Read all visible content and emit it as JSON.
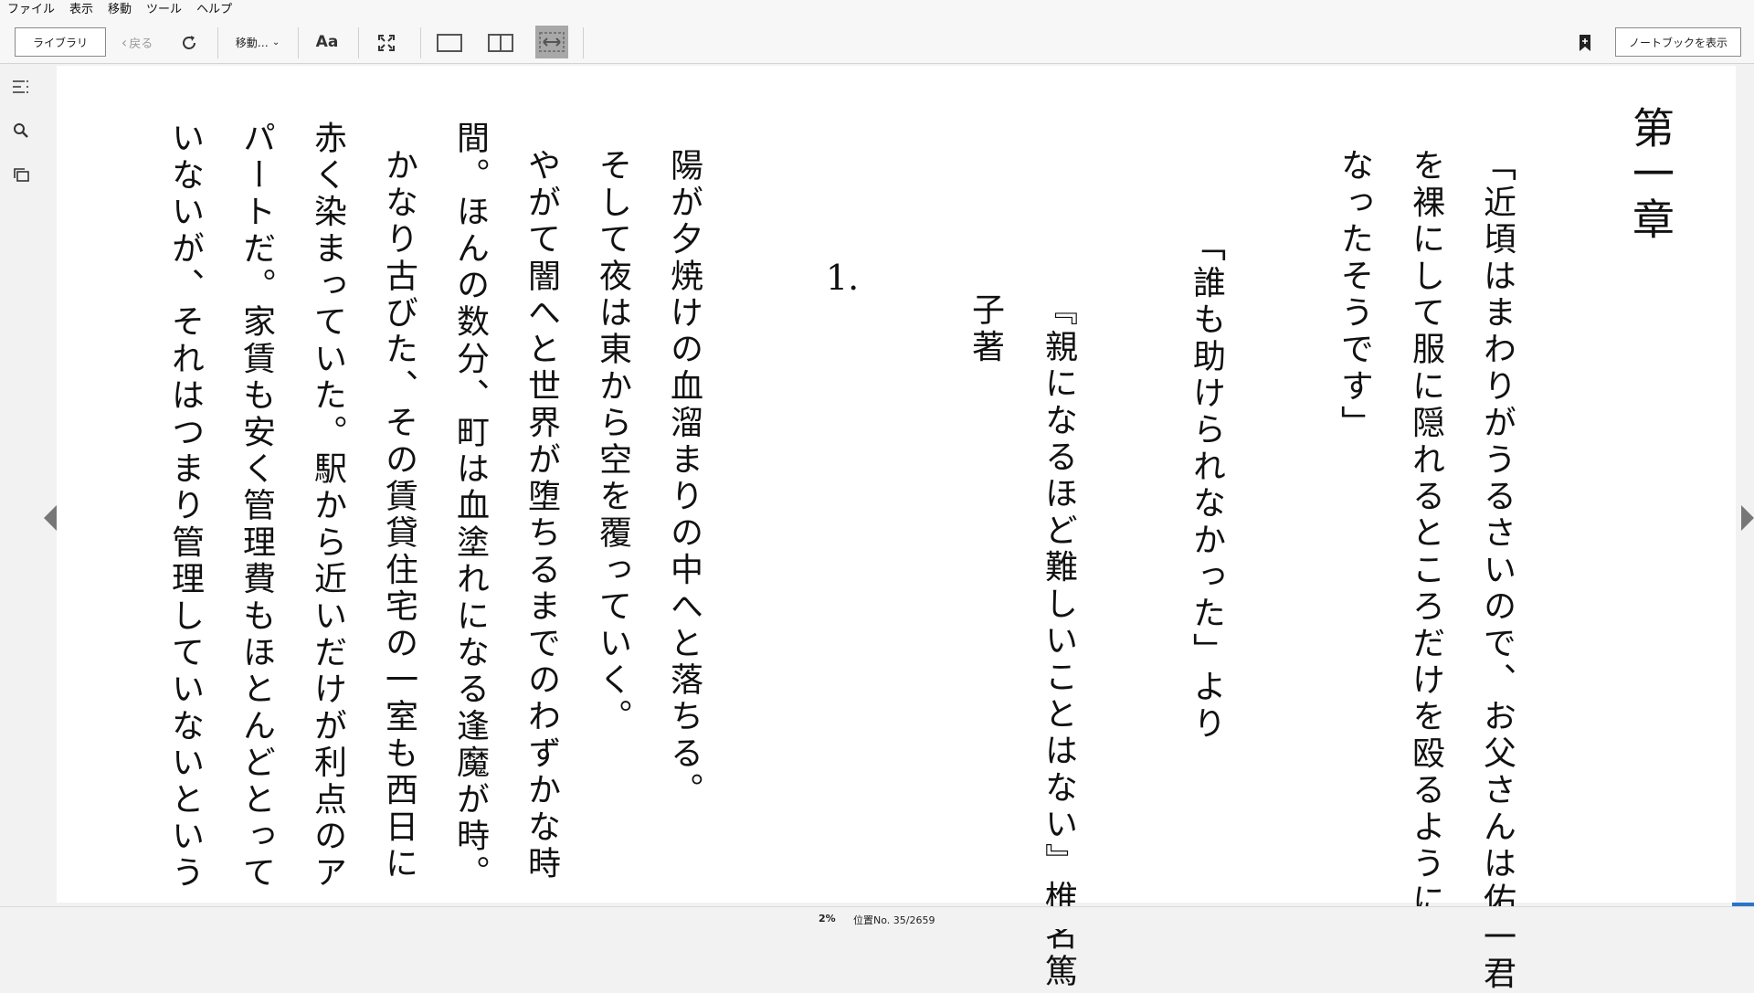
{
  "menu": [
    "ファイル",
    "表示",
    "移動",
    "ツール",
    "ヘルプ"
  ],
  "toolbar": {
    "library_label": "ライブラリ",
    "back_label": "戻る",
    "goto_label": "移動…",
    "font_label": "Aa",
    "notebook_label": "ノートブックを表示"
  },
  "book": {
    "chapter_title": "第一章",
    "epigraph_lines": [
      "「近頃はまわりがうるさいので、お父さんは佑一君",
      "を裸にして服に隠れるところだけを殴るように",
      "なったそうです」"
    ],
    "quote_line": "「誰も助けられなかった」より",
    "source_line": "『親になるほど難しいことはない』椎名篤",
    "source_line_2": "子著",
    "section_number": "1.",
    "body_lines": [
      "陽が夕焼けの血溜まりの中へと落ちる。",
      "そして夜は東から空を覆っていく。",
      "やがて闇へと世界が堕ちるまでのわずかな時",
      "間。ほんの数分、町は血塗れになる逢魔が時。",
      "かなり古びた、その賃貸住宅の一室も西日に",
      "赤く染まっていた。駅から近いだけが利点のア",
      "パートだ。家賃も安く管理費もほとんどとって",
      "いないが、それはつまり管理していないという"
    ]
  },
  "status": {
    "percent": "2%",
    "location": "位置No. 35/2659"
  }
}
